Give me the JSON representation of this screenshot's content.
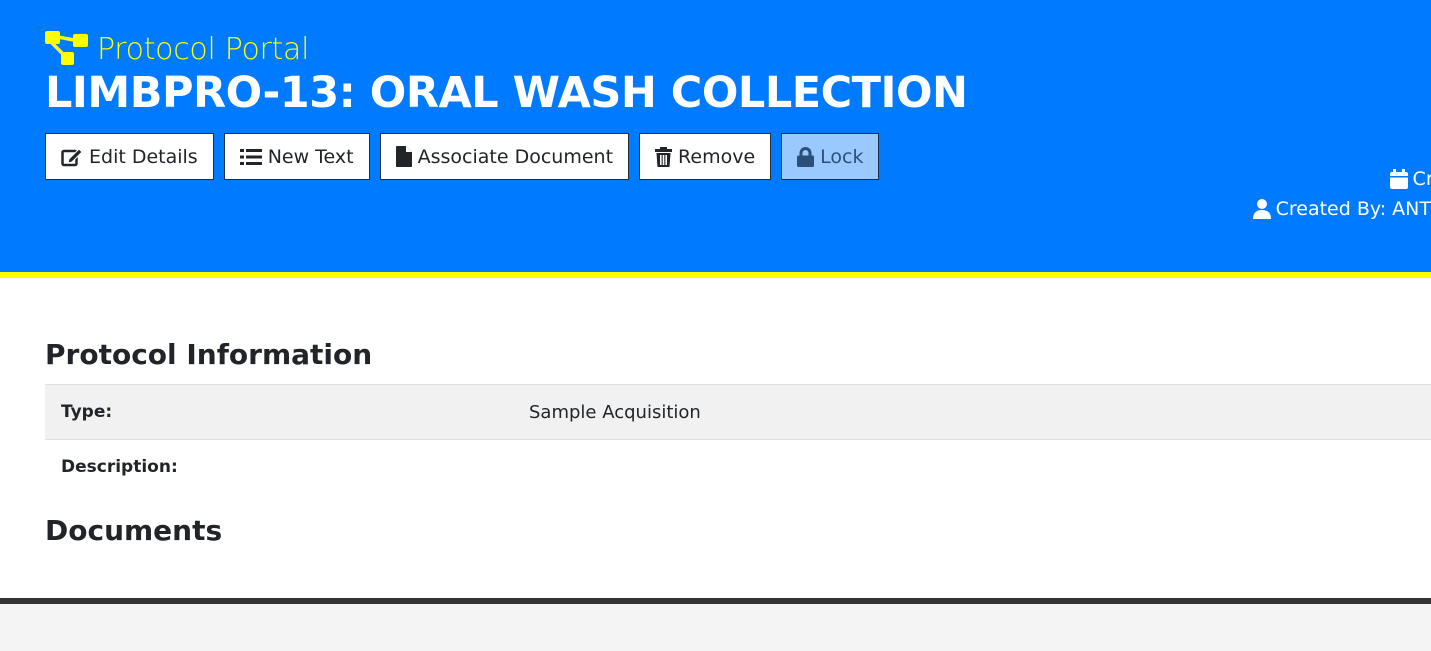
{
  "header": {
    "brand": "Protocol Portal",
    "title": "LIMBPRO-13: ORAL WASH COLLECTION",
    "colors": {
      "background": "#007bff",
      "accent": "#ffff00"
    }
  },
  "toolbar": {
    "buttons": [
      {
        "label": "Edit Details",
        "icon": "edit-icon"
      },
      {
        "label": "New Text",
        "icon": "list-icon"
      },
      {
        "label": "Associate Document",
        "icon": "file-icon"
      },
      {
        "label": "Remove",
        "icon": "trash-icon"
      },
      {
        "label": "Lock",
        "icon": "lock-icon"
      }
    ]
  },
  "meta": {
    "created_date_label": "Creat",
    "created_by_label": "Created By: ANT"
  },
  "protocol_info": {
    "heading": "Protocol Information",
    "rows": [
      {
        "label": "Type:",
        "value": "Sample Acquisition"
      },
      {
        "label": "Description:",
        "value": ""
      }
    ]
  },
  "documents": {
    "heading": "Documents"
  }
}
